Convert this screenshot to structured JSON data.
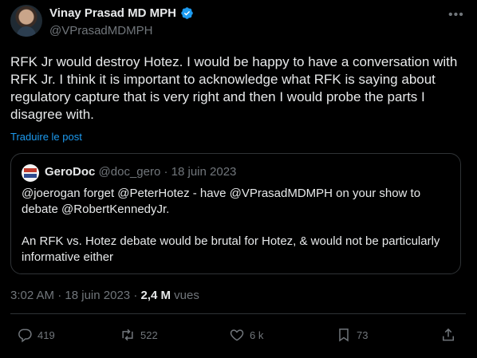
{
  "author": {
    "display_name": "Vinay Prasad MD MPH",
    "handle": "@VPrasadMDMPH",
    "verified_icon": "verified-badge-icon",
    "badge_color": "#1d9bf0"
  },
  "tweet": {
    "text": "RFK Jr would destroy Hotez. I would be happy to have a conversation with RFK Jr. I think it is important to acknowledge what RFK is saying about regulatory capture that is very right and then I would probe the parts I disagree with.",
    "translate_label": "Traduire le post",
    "time": "3:02 AM",
    "date": "18 juin 2023",
    "views_count": "2,4 M",
    "views_label": "vues"
  },
  "quote": {
    "display_name": "GeroDoc",
    "handle": "@doc_gero",
    "date": "18 juin 2023",
    "paragraphs": [
      "@joerogan forget @PeterHotez - have @VPrasadMDMPH on your show to debate @RobertKennedyJr.",
      "An RFK vs. Hotez debate would be brutal for Hotez, & would not be particularly informative either"
    ]
  },
  "actions": {
    "replies": "419",
    "reposts": "522",
    "likes": "6 k",
    "bookmarks": "73"
  },
  "colors": {
    "background": "#000000",
    "text": "#e7e9ea",
    "muted": "#71767b",
    "accent": "#1d9bf0",
    "border": "#2f3336"
  }
}
